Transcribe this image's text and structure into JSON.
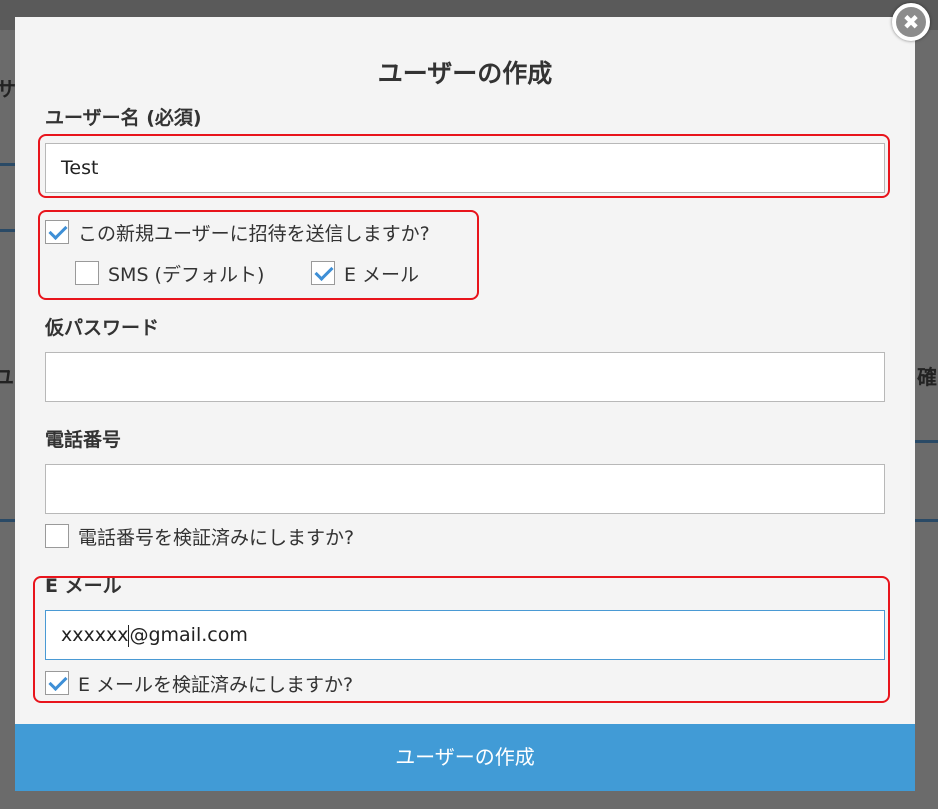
{
  "background": {
    "fragments": [
      "サ",
      "ユ",
      "確"
    ]
  },
  "modal": {
    "title": "ユーザーの作成",
    "close_icon": "close-icon"
  },
  "fields": {
    "username": {
      "label": "ユーザー名 (必須)",
      "value": "Test"
    },
    "invite": {
      "label": "この新規ユーザーに招待を送信しますか?",
      "checked": true,
      "sms": {
        "label": "SMS (デフォルト)",
        "checked": false
      },
      "email": {
        "label": "E メール",
        "checked": true
      }
    },
    "temp_password": {
      "label": "仮パスワード",
      "value": ""
    },
    "phone": {
      "label": "電話番号",
      "value": "",
      "verified": {
        "label": "電話番号を検証済みにしますか?",
        "checked": false
      }
    },
    "email": {
      "label": "E メール",
      "value_before_caret": "xxxxxx",
      "value_after_caret": "@gmail.com",
      "verified": {
        "label": "E メールを検証済みにしますか?",
        "checked": true
      }
    }
  },
  "submit": {
    "label": "ユーザーの作成"
  },
  "colors": {
    "accent": "#419bd6",
    "highlight": "#e8141c",
    "checkmark": "#3e8fd6"
  }
}
